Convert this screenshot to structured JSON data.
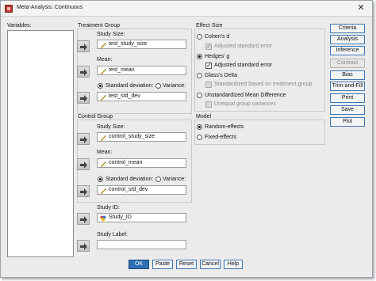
{
  "window": {
    "title": "Meta-Analysis: Continuous",
    "close_glyph": "✕"
  },
  "variables": {
    "label": "Variables:"
  },
  "treatment": {
    "title": "Treatment Group",
    "study_size_label": "Study Size:",
    "study_size_value": "test_study_size",
    "mean_label": "Mean:",
    "mean_value": "test_mean",
    "std_dev_label": "Standard deviation:",
    "variance_label": "Variance:",
    "std_value": "test_std_dev",
    "selected": "Standard deviation"
  },
  "control": {
    "title": "Control Group",
    "study_size_label": "Study Size:",
    "study_size_value": "control_study_size",
    "mean_label": "Mean:",
    "mean_value": "control_mean",
    "std_dev_label": "Standard deviation:",
    "variance_label": "Variance:",
    "std_value": "control_std_dev",
    "selected": "Standard deviation"
  },
  "study_id": {
    "label": "Study ID:",
    "value": "Study_ID"
  },
  "study_label": {
    "label": "Study Label:",
    "value": ""
  },
  "effect_size": {
    "title": "Effect Size",
    "cohens_d": "Cohen's d",
    "cohens_adjusted": "Adjusted standard error",
    "hedges_g": "Hedges' g",
    "hedges_adjusted": "Adjusted standard error",
    "glass_delta": "Glass's Delta",
    "glass_standardized": "Standardized based on treatment group",
    "unstandardized": "Unstandardized Mean Difference",
    "unequal_variances": "Unequal group variances",
    "selected": "Hedges' g"
  },
  "model": {
    "title": "Model",
    "random": "Random-effects",
    "fixed": "Fixed-effects",
    "selected": "Random-effects"
  },
  "side_buttons": [
    "Criteria",
    "Analysis",
    "Inference",
    "Contrast",
    "Bias",
    "Trim-and-Fill",
    "Print",
    "Save",
    "Plot"
  ],
  "bottom_buttons": [
    "OK",
    "Paste",
    "Reset",
    "Cancel",
    "Help"
  ],
  "colors": {
    "accent_border": "#3d77b5",
    "primary": "#2f6fb5",
    "dialog_bg": "#ebebeb"
  },
  "icons": {
    "field_scale": "pencil-scale-icon",
    "field_nominal": "nominal-variable-icon",
    "move": "right-arrow-icon"
  }
}
